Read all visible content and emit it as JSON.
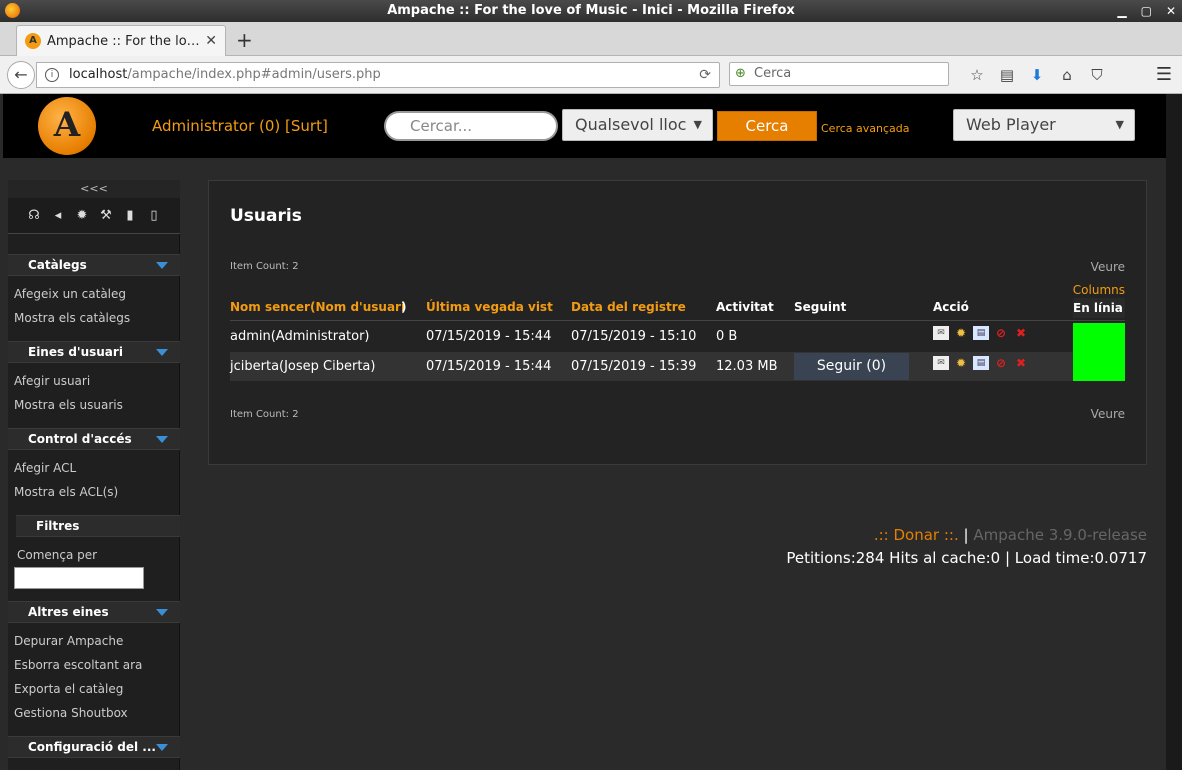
{
  "window": {
    "title": "Ampache :: For the love of Music - Inici - Mozilla Firefox"
  },
  "tab": {
    "icon": "A",
    "title": "Ampache :: For the lo…",
    "close": "✕",
    "new": "+"
  },
  "nav": {
    "url_host": "localhost",
    "url_path": "/ampache/index.php#admin/users.php",
    "search_placeholder": "Cerca"
  },
  "header": {
    "logo": "A",
    "user": "Administrator (0) [Surt]",
    "search_placeholder": "Cercar...",
    "where": "Qualsevol lloc",
    "search_button": "Cerca",
    "advanced": "Cerca avançada",
    "player": "Web Player"
  },
  "sidebar": {
    "collapse": "<<<",
    "sections": [
      {
        "title": "Catàlegs",
        "links": [
          "Afegeix un catàleg",
          "Mostra els catàlegs"
        ]
      },
      {
        "title": "Eines d'usuari",
        "links": [
          "Afegir usuari",
          "Mostra els usuaris"
        ]
      },
      {
        "title": "Control d'accés",
        "links": [
          "Afegir ACL",
          "Mostra els ACL(s)"
        ]
      },
      {
        "title": "Filtres",
        "label": "Comença per"
      },
      {
        "title": "Altres eines",
        "links": [
          "Depurar Ampache",
          "Esborra escoltant ara",
          "Exporta el catàleg",
          "Gestiona Shoutbox"
        ]
      },
      {
        "title": "Configuració del ..."
      }
    ]
  },
  "main": {
    "title": "Usuaris",
    "item_count": "Item Count: 2",
    "veure": "Veure",
    "columns": "Columns",
    "headers": {
      "fullname": "Nom sencer",
      "username": "(Nom d'usuari",
      "username_close": ")",
      "last_seen": "Última vegada vist",
      "registered": "Data del registre",
      "activity": "Activitat",
      "following": "Seguint",
      "action": "Acció",
      "online": "En línia"
    },
    "rows": [
      {
        "name": "admin(Administrator)",
        "last": "07/15/2019 - 15:44",
        "reg": "07/15/2019 - 15:10",
        "activity": "0 B",
        "follow": ""
      },
      {
        "name": "jciberta(Josep Ciberta)",
        "last": "07/15/2019 - 15:44",
        "reg": "07/15/2019 - 15:39",
        "activity": "12.03 MB",
        "follow": "Seguir (0)"
      }
    ],
    "online_color": "#00ff00"
  },
  "footer": {
    "donate": ".:: Donar ::.",
    "separator": "|",
    "version": "Ampache 3.9.0-release",
    "stats": "Petitions:284 Hits al cache:0 | Load time:0.0717"
  }
}
